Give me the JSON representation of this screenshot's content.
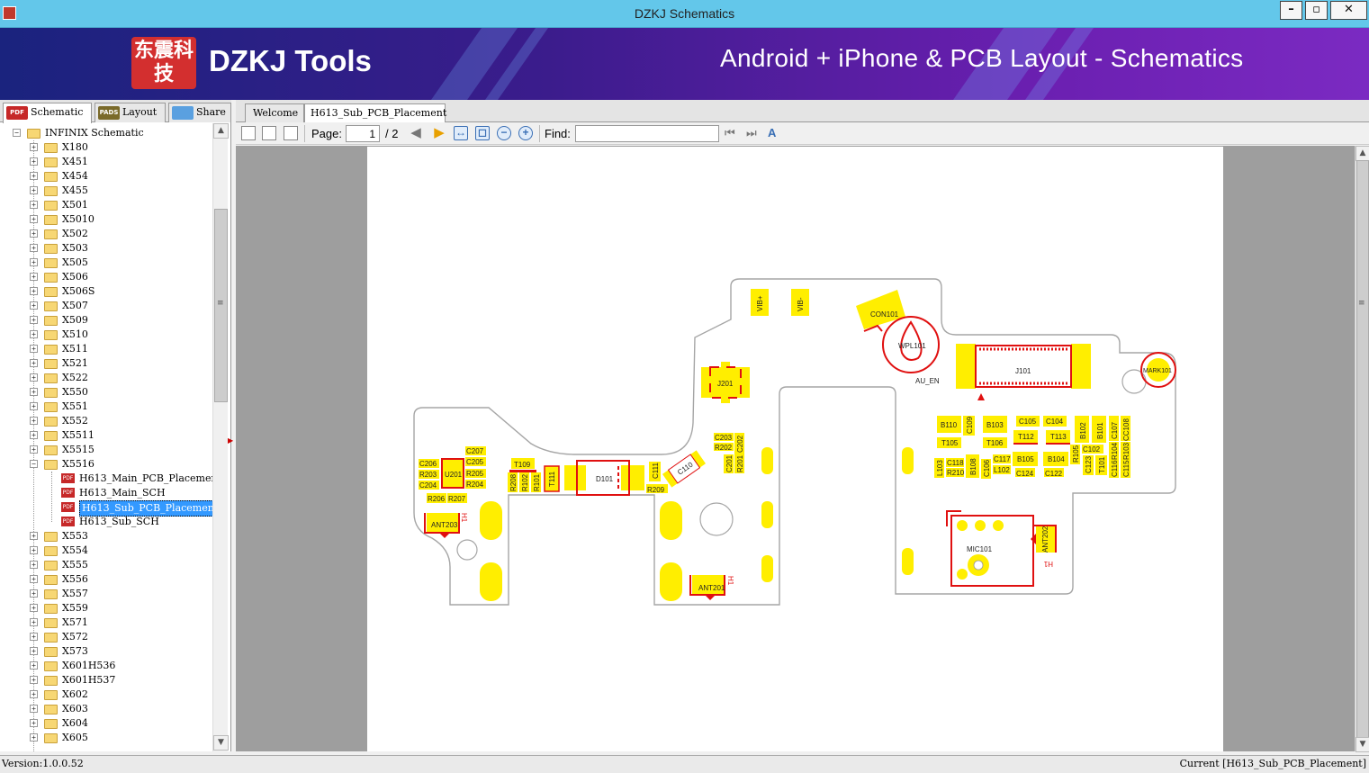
{
  "window": {
    "title": "DZKJ Schematics",
    "minimize": "–",
    "restore": "▫",
    "close": "✕"
  },
  "banner": {
    "logo_text": "东震科技",
    "brand": "DZKJ Tools",
    "tagline": "Android + iPhone & PCB Layout - Schematics"
  },
  "left_tabs": [
    {
      "label": "Schematic",
      "icon": "PDF",
      "active": true
    },
    {
      "label": "Layout",
      "icon": "PADS",
      "active": false
    },
    {
      "label": "Share",
      "icon": "share",
      "active": false
    }
  ],
  "tree": {
    "root": "INFINIX Schematic",
    "folders_before": [
      "X180",
      "X451",
      "X454",
      "X455",
      "X501",
      "X5010",
      "X502",
      "X503",
      "X505",
      "X506",
      "X506S",
      "X507",
      "X509",
      "X510",
      "X511",
      "X521",
      "X522",
      "X550",
      "X551",
      "X552",
      "X5511",
      "X5515"
    ],
    "open_folder": "X5516",
    "files": [
      "H613_Main_PCB_Placement",
      "H613_Main_SCH",
      "H613_Sub_PCB_Placement",
      "H613_Sub_SCH"
    ],
    "selected_file": "H613_Sub_PCB_Placement",
    "folders_after": [
      "X553",
      "X554",
      "X555",
      "X556",
      "X557",
      "X559",
      "X571",
      "X572",
      "X573",
      "X601H536",
      "X601H537",
      "X602",
      "X603",
      "X604",
      "X605"
    ]
  },
  "doc_tabs": [
    {
      "label": "Welcome",
      "active": false
    },
    {
      "label": "H613_Sub_PCB_Placement",
      "active": true
    }
  ],
  "toolbar": {
    "page_label": "Page:",
    "page_value": "1",
    "page_total": "/ 2",
    "find_label": "Find:",
    "find_value": ""
  },
  "pcb": {
    "labels": {
      "vibp": "VIB+",
      "vibm": "VIB-",
      "con101": "CON101",
      "wpl101": "WPL101",
      "j101": "J101",
      "au_en": "AU_EN",
      "mark101": "MARK101",
      "j201": "J201",
      "c203": "C203",
      "r202": "R202",
      "c202": "C202",
      "c201": "C201",
      "r201": "R201",
      "c110": "C110",
      "c111": "C111",
      "r209": "R209",
      "d101": "D101",
      "t111": "T111",
      "t109": "T109",
      "r208": "R208",
      "r102": "R102",
      "r101": "R101",
      "c207": "C207",
      "c205": "C205",
      "r205": "R205",
      "r204": "R204",
      "c206": "C206",
      "r203": "R203",
      "c204": "C204",
      "u201": "U201",
      "r206": "R206",
      "r207": "R207",
      "ant203": "ANT203",
      "ant201": "ANT201",
      "ant202": "ANT202",
      "h1": "H1",
      "mic101": "MIC101",
      "b110": "B110",
      "c109": "C109",
      "b103": "B103",
      "c105": "C105",
      "c104": "C104",
      "b102": "B102",
      "b101": "B101",
      "c107": "C107",
      "cc108": "CC108",
      "t105": "T105",
      "t106": "T106",
      "t112": "T112",
      "t113": "T113",
      "r105": "R105",
      "c102": "C102",
      "r104": "R104",
      "r103": "R103",
      "c115": "C115",
      "c116": "C116",
      "t101": "T101",
      "c123": "C123",
      "l103": "L103",
      "c118": "C118",
      "r210": "R210",
      "b108": "B108",
      "c106": "C106",
      "c117": "C117",
      "l102": "L102",
      "b105": "B105",
      "b104": "B104",
      "c124": "C124",
      "c122": "C122"
    }
  },
  "status": {
    "version": "Version:1.0.0.52",
    "current": "Current [H613_Sub_PCB_Placement]"
  },
  "colors": {
    "titlebar": "#63c7ea",
    "pad_yellow": "#ffee00",
    "outline_red": "#e01010",
    "selection": "#3399ff"
  }
}
